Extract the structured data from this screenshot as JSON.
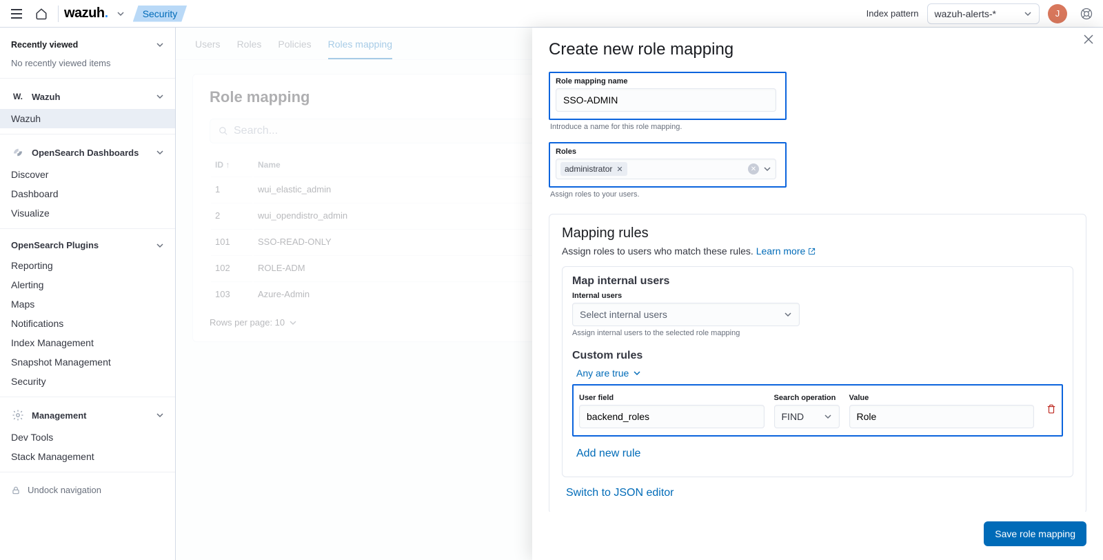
{
  "topbar": {
    "brand_main": "wazuh",
    "brand_dot": ".",
    "breadcrumb_current": "Security",
    "index_pattern_label": "Index pattern",
    "index_pattern_value": "wazuh-alerts-*",
    "avatar_initial": "J"
  },
  "sidebar": {
    "recently_viewed_label": "Recently viewed",
    "recently_viewed_empty": "No recently viewed items",
    "app_group_label": "Wazuh",
    "app_group_short": "W.",
    "app_item_wazuh": "Wazuh",
    "osd_group_label": "OpenSearch Dashboards",
    "osd_items": {
      "discover": "Discover",
      "dashboard": "Dashboard",
      "visualize": "Visualize"
    },
    "plugins_group_label": "OpenSearch Plugins",
    "plugins_items": {
      "reporting": "Reporting",
      "alerting": "Alerting",
      "maps": "Maps",
      "notifications": "Notifications",
      "index_mgmt": "Index Management",
      "snapshot_mgmt": "Snapshot Management",
      "security": "Security"
    },
    "mgmt_group_label": "Management",
    "mgmt_items": {
      "devtools": "Dev Tools",
      "stack": "Stack Management"
    },
    "undock_label": "Undock navigation"
  },
  "tabs": {
    "users": "Users",
    "roles": "Roles",
    "policies": "Policies",
    "roles_mapping": "Roles mapping"
  },
  "page": {
    "title": "Role mapping",
    "search_placeholder": "Search...",
    "col_id": "ID",
    "col_name": "Name",
    "rows": [
      {
        "id": "1",
        "name": "wui_elastic_admin"
      },
      {
        "id": "2",
        "name": "wui_opendistro_admin"
      },
      {
        "id": "101",
        "name": "SSO-READ-ONLY"
      },
      {
        "id": "102",
        "name": "ROLE-ADM"
      },
      {
        "id": "103",
        "name": "Azure-Admin"
      }
    ],
    "rows_per_page_label": "Rows per page: 10"
  },
  "flyout": {
    "title": "Create new role mapping",
    "name_label": "Role mapping name",
    "name_value": "SSO-ADMIN",
    "name_help": "Introduce a name for this role mapping.",
    "roles_label": "Roles",
    "roles_chip": "administrator",
    "roles_help": "Assign roles to your users.",
    "rules_heading": "Mapping rules",
    "rules_sub": "Assign roles to users who match these rules. ",
    "rules_learn": "Learn more",
    "map_users_heading": "Map internal users",
    "internal_users_label": "Internal users",
    "internal_users_placeholder": "Select internal users",
    "internal_users_hint": "Assign internal users to the selected role mapping",
    "custom_rules_heading": "Custom rules",
    "any_true_label": "Any are true",
    "rule_user_field_label": "User field",
    "rule_user_field_value": "backend_roles",
    "rule_op_label": "Search operation",
    "rule_op_value": "FIND",
    "rule_value_label": "Value",
    "rule_value_value": "Role",
    "add_rule_link": "Add new rule",
    "json_link": "Switch to JSON editor",
    "save_btn": "Save role mapping"
  }
}
